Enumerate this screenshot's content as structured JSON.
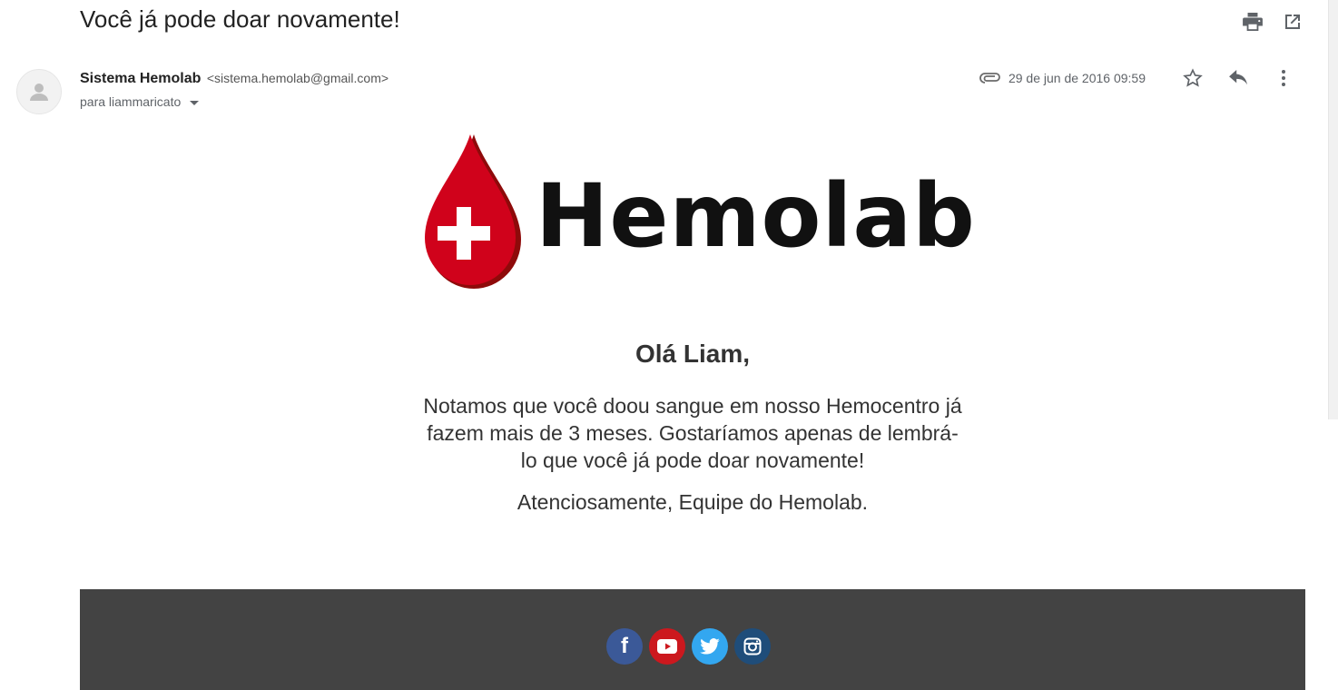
{
  "email": {
    "subject": "Você já pode doar novamente!",
    "sender_name": "Sistema Hemolab",
    "sender_email": "<sistema.hemolab@gmail.com>",
    "recipient": "para liammaricato",
    "date": "29 de jun de 2016 09:59"
  },
  "toolbar": {
    "icons": [
      "print-icon",
      "open-in-new-window-icon",
      "attachment-icon",
      "star-icon",
      "reply-icon",
      "more-options-icon"
    ]
  },
  "body": {
    "logo_text": "Hemolab",
    "greeting": "Olá Liam,",
    "message": "Notamos que você doou sangue em nosso Hemocentro já fazem mais de 3 meses. Gostaríamos apenas de lembrá-lo que você já pode doar novamente!",
    "signoff": "Atenciosamente, Equipe do Hemolab."
  },
  "footer": {
    "social": [
      {
        "name": "facebook",
        "glyph": "f",
        "color": "#3b5998"
      },
      {
        "name": "youtube",
        "glyph": "▶",
        "color": "#cc181e"
      },
      {
        "name": "twitter",
        "glyph": "t",
        "color": "#33a7f0"
      },
      {
        "name": "instagram",
        "glyph": "◎",
        "color": "#1f4d7a"
      }
    ]
  },
  "colors": {
    "drop_red": "#d0021b",
    "drop_dark": "#8e0a0a",
    "footer_bg": "#434343"
  }
}
